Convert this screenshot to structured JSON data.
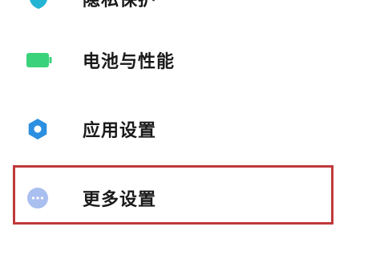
{
  "settings_items": [
    {
      "id": "privacy",
      "label": "隐私保护",
      "icon": "privacy-shield-icon",
      "icon_color": "#23b5d3"
    },
    {
      "id": "battery",
      "label": "电池与性能",
      "icon": "battery-icon",
      "icon_color": "#3ad27a"
    },
    {
      "id": "apps",
      "label": "应用设置",
      "icon": "gear-icon",
      "icon_color": "#2d8fe0"
    },
    {
      "id": "more",
      "label": "更多设置",
      "icon": "more-dots-icon",
      "icon_color": "#a9bff0"
    }
  ],
  "highlight": {
    "target": "more",
    "color": "#c0393b"
  }
}
